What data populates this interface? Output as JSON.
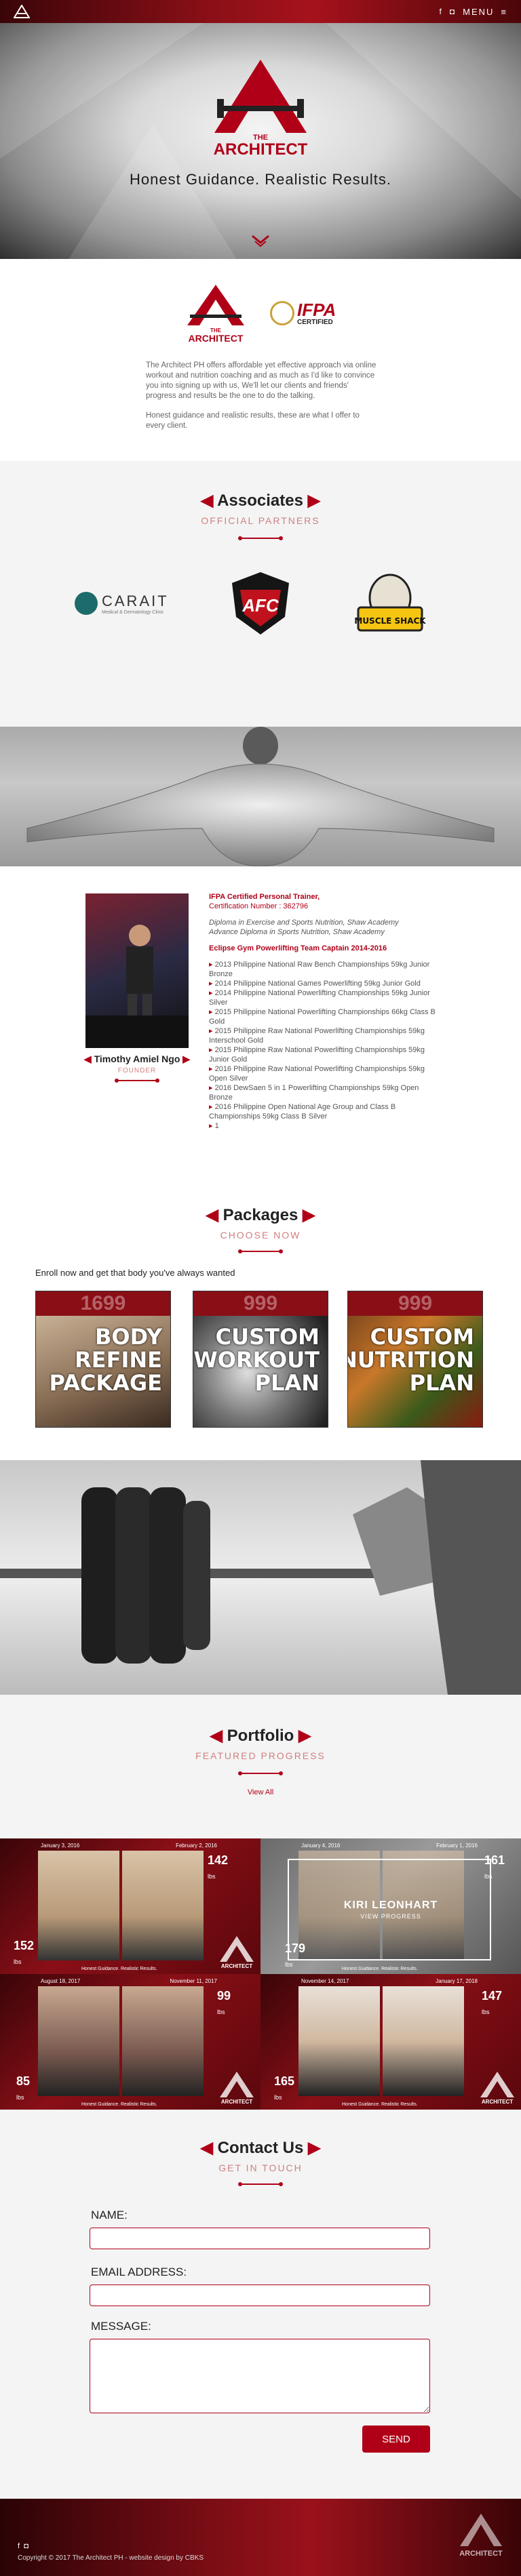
{
  "nav": {
    "menu_label": "MENU",
    "social_icons": [
      "facebook-icon",
      "instagram-icon"
    ]
  },
  "hero": {
    "brand_top": "THE",
    "brand_name": "ARCHITECT",
    "tagline": "Honest Guidance. Realistic Results."
  },
  "about": {
    "badge_name": "IFPA",
    "badge_sub": "CERTIFIED",
    "paragraph1": "The Architect PH offers affordable yet effective approach via online workout and nutrition coaching and as much as I'd like to convince you into signing up with us, We'll let our clients and friends' progress and results be the one to do the talking.",
    "paragraph2": "Honest guidance and realistic results, these are what I offer to every client."
  },
  "associates": {
    "title": "Associates",
    "subtitle": "OFFICIAL PARTNERS",
    "partners": [
      {
        "name": "CARAIT",
        "sub": "Medical & Dermatology Clinic"
      },
      {
        "name": "AFC",
        "sub": ""
      },
      {
        "name": "MUSCLE SHACK",
        "sub": ""
      }
    ]
  },
  "founder": {
    "name": "Timothy Amiel Ngo",
    "role": "FOUNDER",
    "headline": "IFPA Certified Personal Trainer,",
    "cert": "Certification Number : 362796",
    "diploma1": "Diploma in Exercise and Sports Nutrition, Shaw Academy",
    "diploma2": "Advance Diploma in Sports Nutrition, Shaw Academy",
    "captain": "Eclipse Gym Powerlifting Team Captain 2014-2016",
    "achievements": [
      "2013 Philippine National Raw Bench Championships 59kg Junior Bronze",
      "2014 Philippine National Games Powerlifting 59kg Junior Gold",
      "2014 Philippine National Powerlifting Championships 59kg Junior Silver",
      "2015 Philippine National Powerlifting Championships 66kg Class B Gold",
      "2015 Philippine Raw National Powerlifting Championships 59kg Interschool Gold",
      "2015 Philippine Raw National Powerlifting Championships 59kg Junior Gold",
      "2016 Philippine Raw National Powerlifting Championships 59kg Open Silver",
      "2016 DewSaen 5 in 1 Powerlifting Championships 59kg Open Bronze",
      "2016 Philippine Open National Age Group and Class B Championships 59kg Class B Silver",
      "1"
    ]
  },
  "packages": {
    "title": "Packages",
    "subtitle": "CHOOSE NOW",
    "enroll_text": "Enroll now and get that body you've always wanted",
    "items": [
      {
        "price": "1699",
        "line1": "BODY",
        "line2": "REFINE",
        "line3": "PACKAGE"
      },
      {
        "price": "999",
        "line1": "CUSTOM",
        "line2": "WORKOUT",
        "line3": "PLAN"
      },
      {
        "price": "999",
        "line1": "CUSTOM",
        "line2": "NUTRITION",
        "line3": "PLAN"
      }
    ]
  },
  "portfolio": {
    "title": "Portfolio",
    "subtitle": "FEATURED PROGRESS",
    "view_all": "View All",
    "cards": [
      {
        "date1": "January 3, 2016",
        "date2": "February 2, 2016",
        "lbs_after": "142",
        "lbs_before": "152",
        "unit": "lbs",
        "caption": "Honest Guidance. Realistic Results."
      },
      {
        "date1": "January 4, 2016",
        "date2": "February 1, 2016",
        "lbs_after": "161",
        "lbs_before": "179",
        "unit": "lbs",
        "client_name": "KIRI LEONHART",
        "client_action": "VIEW PROGRESS",
        "caption": "Honest Guidance. Realistic Results."
      },
      {
        "date1": "August 18, 2017",
        "date2": "November 11, 2017",
        "lbs_after": "99",
        "lbs_before": "85",
        "unit": "lbs",
        "caption": "Honest Guidance. Realistic Results."
      },
      {
        "date1": "November 14, 2017",
        "date2": "January 17, 2018",
        "lbs_after": "147",
        "lbs_before": "165",
        "unit": "lbs",
        "caption": "Honest Guidance. Realistic Results."
      }
    ]
  },
  "contact": {
    "title": "Contact Us",
    "subtitle": "GET IN TOUCH",
    "name_label": "NAME:",
    "email_label": "EMAIL ADDRESS:",
    "message_label": "MESSAGE:",
    "send_label": "SEND"
  },
  "footer": {
    "copyright": "Copyright © 2017 The Architect PH - website design by CBKS",
    "brand_name": "ARCHITECT"
  },
  "colors": {
    "brand_red": "#b00018",
    "dark_red": "#6a0a10"
  }
}
